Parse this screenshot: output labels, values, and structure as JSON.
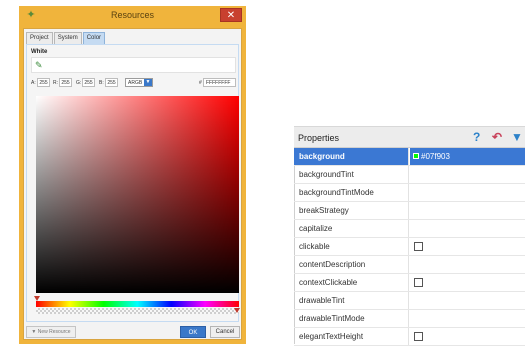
{
  "dialog": {
    "title": "Resources",
    "close_glyph": "✕",
    "tabs": [
      {
        "label": "Project",
        "active": false
      },
      {
        "label": "System",
        "active": false
      },
      {
        "label": "Color",
        "active": true
      }
    ],
    "color_name": "White",
    "argb": {
      "a_label": "A:",
      "a_value": "255",
      "r_label": "R:",
      "r_value": "255",
      "g_label": "G:",
      "g_value": "255",
      "b_label": "B:",
      "b_value": "255",
      "mode": "ARGB",
      "hash_label": "#",
      "hex": "FFFFFFFF"
    },
    "new_resource_label": "▼ New Resource",
    "ok_label": "OK",
    "cancel_label": "Cancel",
    "icons": [
      "app-icon",
      "eyedropper-icon",
      "close-icon",
      "dropdown-arrow-icon"
    ]
  },
  "properties": {
    "title": "Properties",
    "icons": [
      "help-icon",
      "undo-icon",
      "filter-icon"
    ],
    "rows": [
      {
        "name": "background",
        "value": "#07f903",
        "type": "color",
        "swatch": "#07f903",
        "selected": true
      },
      {
        "name": "backgroundTint",
        "value": "",
        "type": "text"
      },
      {
        "name": "backgroundTintMode",
        "value": "",
        "type": "text"
      },
      {
        "name": "breakStrategy",
        "value": "",
        "type": "text"
      },
      {
        "name": "capitalize",
        "value": "",
        "type": "text"
      },
      {
        "name": "clickable",
        "value": "",
        "type": "checkbox"
      },
      {
        "name": "contentDescription",
        "value": "",
        "type": "text"
      },
      {
        "name": "contextClickable",
        "value": "",
        "type": "checkbox"
      },
      {
        "name": "drawableTint",
        "value": "",
        "type": "text"
      },
      {
        "name": "drawableTintMode",
        "value": "",
        "type": "text"
      },
      {
        "name": "elegantTextHeight",
        "value": "",
        "type": "checkbox"
      }
    ]
  }
}
